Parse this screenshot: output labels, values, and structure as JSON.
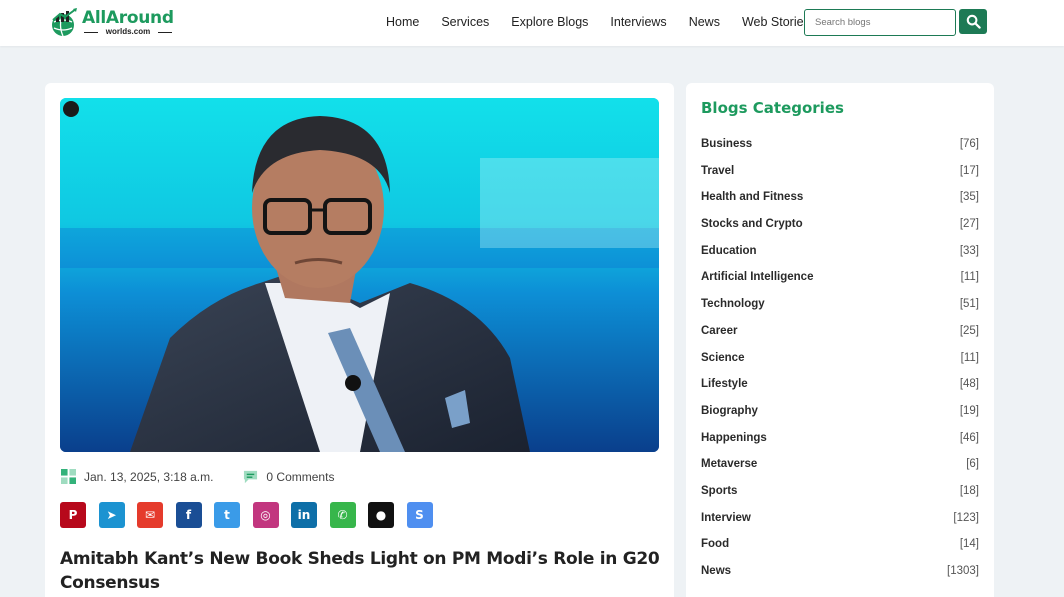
{
  "brand": {
    "name": "AllAround",
    "domain": "worlds.com",
    "color": "#1d9a5e"
  },
  "nav": {
    "items": [
      {
        "label": "Home"
      },
      {
        "label": "Services"
      },
      {
        "label": "Explore Blogs"
      },
      {
        "label": "Interviews"
      },
      {
        "label": "News"
      },
      {
        "label": "Web Stories"
      }
    ]
  },
  "search": {
    "placeholder": "Search blogs",
    "value": "",
    "button_icon": "search-icon"
  },
  "article": {
    "date": "Jan. 13, 2025, 3:18 a.m.",
    "comments": "0 Comments",
    "title": "Amitabh Kant’s New Book Sheds Light on PM Modi’s Role in G20 Consensus",
    "image_icon": "photo-icon",
    "share": [
      {
        "name": "pinterest",
        "glyph": "P",
        "color": "#b7081b"
      },
      {
        "name": "telegram",
        "glyph": "➤",
        "color": "#1c93d1"
      },
      {
        "name": "email",
        "glyph": "✉",
        "color": "#e53b2c"
      },
      {
        "name": "facebook",
        "glyph": "f",
        "color": "#1a4e95"
      },
      {
        "name": "twitter",
        "glyph": "t",
        "color": "#3a9be8"
      },
      {
        "name": "instagram",
        "glyph": "◎",
        "color": "#c2367f"
      },
      {
        "name": "linkedin",
        "glyph": "in",
        "color": "#0e6fa8"
      },
      {
        "name": "whatsapp",
        "glyph": "✆",
        "color": "#37b64b"
      },
      {
        "name": "reddit",
        "glyph": "●",
        "color": "#111111"
      },
      {
        "name": "skype",
        "glyph": "S",
        "color": "#4f8ff0"
      }
    ]
  },
  "sidebar": {
    "title": "Blogs Categories",
    "categories": [
      {
        "name": "Business",
        "count": "[76]"
      },
      {
        "name": "Travel",
        "count": "[17]"
      },
      {
        "name": "Health and Fitness",
        "count": "[35]"
      },
      {
        "name": "Stocks and Crypto",
        "count": "[27]"
      },
      {
        "name": "Education",
        "count": "[33]"
      },
      {
        "name": "Artificial Intelligence",
        "count": "[11]"
      },
      {
        "name": "Technology",
        "count": "[51]"
      },
      {
        "name": "Career",
        "count": "[25]"
      },
      {
        "name": "Science",
        "count": "[11]"
      },
      {
        "name": "Lifestyle",
        "count": "[48]"
      },
      {
        "name": "Biography",
        "count": "[19]"
      },
      {
        "name": "Happenings",
        "count": "[46]"
      },
      {
        "name": "Metaverse",
        "count": "[6]"
      },
      {
        "name": "Sports",
        "count": "[18]"
      },
      {
        "name": "Interview",
        "count": "[123]"
      },
      {
        "name": "Food",
        "count": "[14]"
      },
      {
        "name": "News",
        "count": "[1303]"
      }
    ]
  }
}
